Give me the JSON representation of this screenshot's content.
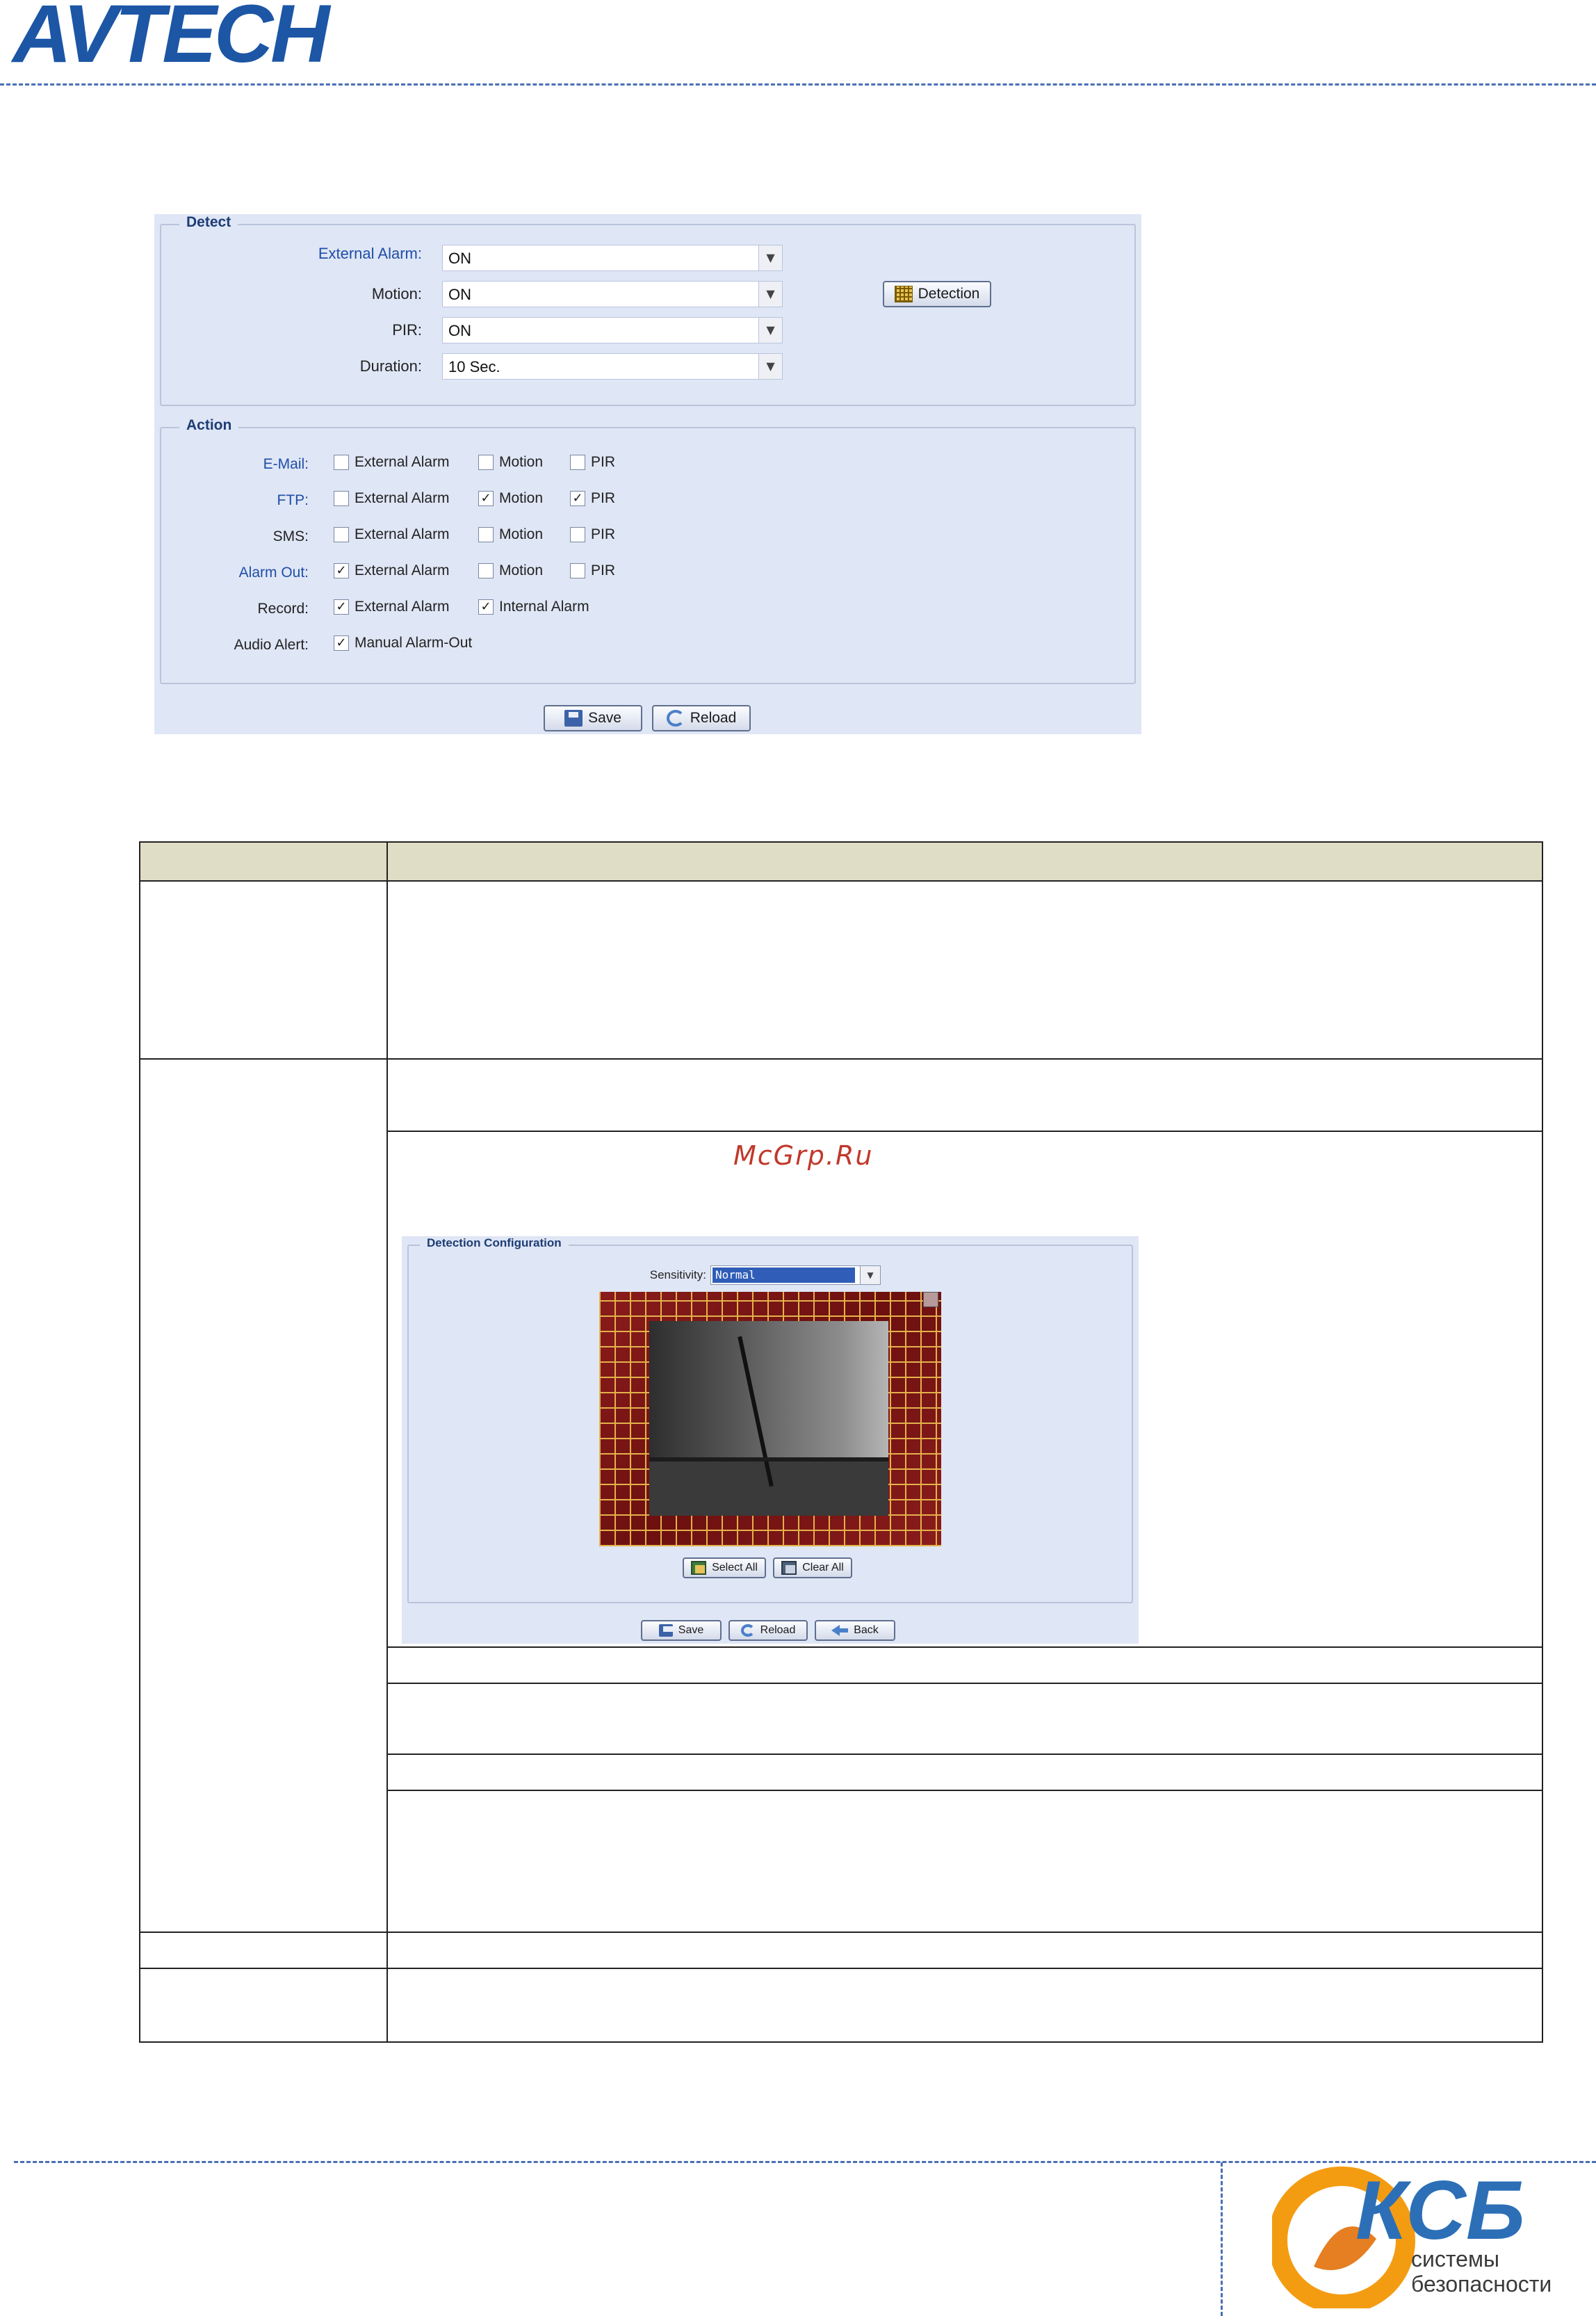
{
  "header": {
    "brand": "AVTECH"
  },
  "panel": {
    "detect": {
      "legend": "Detect",
      "rows": [
        {
          "label": "External Alarm:",
          "value": "ON"
        },
        {
          "label": "Motion:",
          "value": "ON"
        },
        {
          "label": "PIR:",
          "value": "ON"
        },
        {
          "label": "Duration:",
          "value": "10 Sec."
        }
      ],
      "detection_button": "Detection"
    },
    "action": {
      "legend": "Action",
      "rows": [
        {
          "label": "E-Mail:",
          "options": [
            {
              "text": "External Alarm",
              "checked": false
            },
            {
              "text": "Motion",
              "checked": false
            },
            {
              "text": "PIR",
              "checked": false
            }
          ]
        },
        {
          "label": "FTP:",
          "options": [
            {
              "text": "External Alarm",
              "checked": false
            },
            {
              "text": "Motion",
              "checked": true
            },
            {
              "text": "PIR",
              "checked": true
            }
          ]
        },
        {
          "label": "SMS:",
          "options": [
            {
              "text": "External Alarm",
              "checked": false
            },
            {
              "text": "Motion",
              "checked": false
            },
            {
              "text": "PIR",
              "checked": false
            }
          ]
        },
        {
          "label": "Alarm Out:",
          "options": [
            {
              "text": "External Alarm",
              "checked": true
            },
            {
              "text": "Motion",
              "checked": false
            },
            {
              "text": "PIR",
              "checked": false
            }
          ]
        },
        {
          "label": "Record:",
          "options": [
            {
              "text": "External Alarm",
              "checked": true
            },
            {
              "text": "Internal Alarm",
              "checked": true
            }
          ]
        },
        {
          "label": "Audio Alert:",
          "options": [
            {
              "text": "Manual Alarm-Out",
              "checked": true
            }
          ]
        }
      ]
    },
    "buttons": {
      "save": "Save",
      "reload": "Reload"
    }
  },
  "watermark": "McGrp.Ru",
  "detection_config": {
    "legend": "Detection Configuration",
    "sensitivity_label": "Sensitivity:",
    "sensitivity_value": "Normal",
    "select_all": "Select All",
    "clear_all": "Clear All",
    "save": "Save",
    "reload": "Reload",
    "back": "Back"
  },
  "footer": {
    "logo_main": "КСБ",
    "logo_line1": "системы",
    "logo_line2": "безопасности"
  }
}
